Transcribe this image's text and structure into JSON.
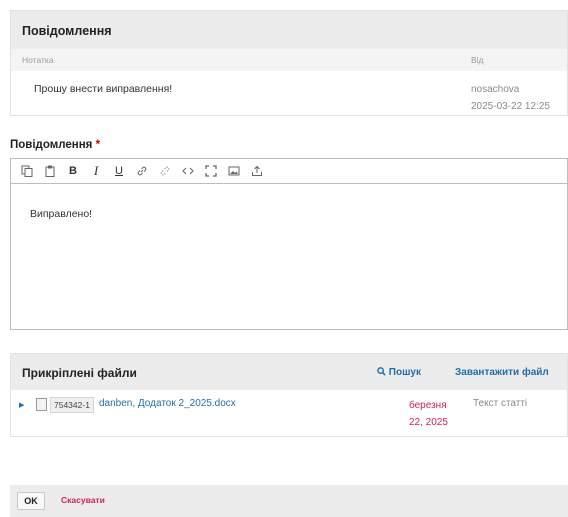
{
  "messages": {
    "title": "Повідомлення",
    "col_note": "Нотатка",
    "col_from": "Від",
    "items": [
      {
        "note": "Прошу внести виправлення!",
        "author": "nosachova",
        "date": "2025-03-22 12:25"
      }
    ]
  },
  "editor": {
    "label": "Повідомлення",
    "required_mark": "*",
    "content": "Виправлено!",
    "toolbar_icons": [
      "copy-icon",
      "paste-icon",
      "bold-icon",
      "italic-icon",
      "underline-icon",
      "link-icon",
      "unlink-icon",
      "code-icon",
      "fullscreen-icon",
      "image-icon",
      "upload-icon"
    ],
    "toolbar_glyphs": {
      "bold": "B",
      "italic": "I",
      "underline": "U"
    }
  },
  "files": {
    "title": "Прикріплені файли",
    "search_label": "Пошук",
    "upload_label": "Завантажити файл",
    "items": [
      {
        "id": "754342-1",
        "name": "danben, Додаток 2_2025.docx",
        "date_line1": "березня",
        "date_line2": "22, 2025",
        "type": "Текст статті"
      }
    ]
  },
  "footer": {
    "ok_label": "OK",
    "cancel_label": "Скасувати"
  },
  "colors": {
    "link": "#1e6fa8",
    "accent": "#d0225a",
    "required": "#d00000"
  }
}
